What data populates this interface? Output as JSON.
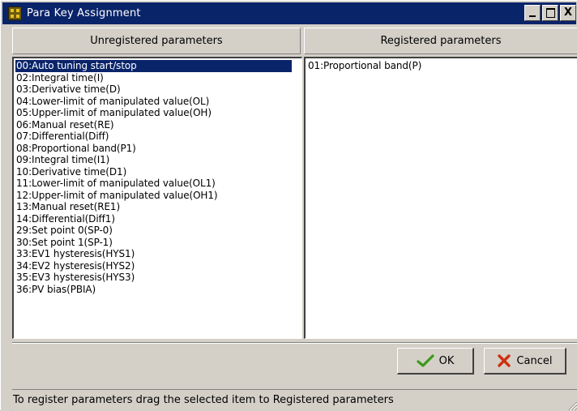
{
  "window": {
    "title": "Para Key Assignment",
    "minimize_glyph": "_",
    "maximize_glyph": "□",
    "close_glyph": "X"
  },
  "unregistered": {
    "header": "Unregistered parameters",
    "items": [
      "00:Auto tuning start/stop",
      "02:Integral time(I)",
      "03:Derivative time(D)",
      "04:Lower-limit of manipulated value(OL)",
      "05:Upper-limit of manipulated value(OH)",
      "06:Manual reset(RE)",
      "07:Differential(Diff)",
      "08:Proportional band(P1)",
      "09:Integral time(I1)",
      "10:Derivative time(D1)",
      "11:Lower-limit of manipulated value(OL1)",
      "12:Upper-limit of manipulated value(OH1)",
      "13:Manual reset(RE1)",
      "14:Differential(Diff1)",
      "29:Set point 0(SP-0)",
      "30:Set point 1(SP-1)",
      "33:EV1 hysteresis(HYS1)",
      "34:EV2 hysteresis(HYS2)",
      "35:EV3 hysteresis(HYS3)",
      "36:PV bias(PBIA)"
    ],
    "selected_index": 0
  },
  "registered": {
    "header": "Registered parameters",
    "items": [
      "01:Proportional band(P)"
    ]
  },
  "buttons": {
    "ok_label": "OK",
    "cancel_label": "Cancel"
  },
  "status": {
    "text": "To register parameters drag the selected item to Registered parameters"
  },
  "colors": {
    "titlebar": "#0a246a",
    "selection": "#0a246a",
    "face": "#d4d0c8",
    "ok_check": "#3a9a1a",
    "cancel_x": "#d03010"
  },
  "icons": {
    "app": "app-icon",
    "ok": "check-icon",
    "cancel": "x-icon"
  }
}
